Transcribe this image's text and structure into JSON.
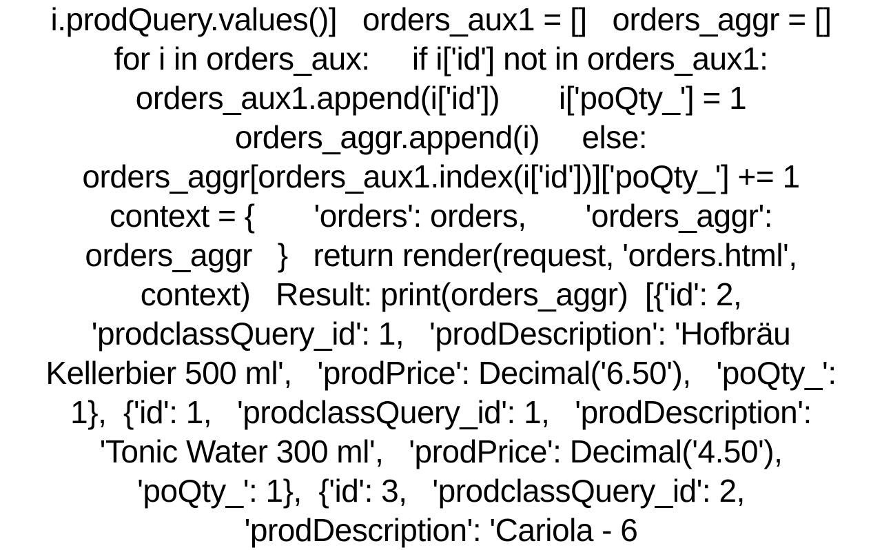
{
  "text_block": "i.prodQuery.values()]   orders_aux1 = []   orders_aggr = []   for i in orders_aux:     if i['id'] not in orders_aux1:       orders_aux1.append(i['id'])       i['poQty_'] = 1       orders_aggr.append(i)     else:       orders_aggr[orders_aux1.index(i['id'])]['poQty_'] += 1   context = {       'orders': orders,       'orders_aggr': orders_aggr   }   return render(request, 'orders.html', context)   Result: print(orders_aggr)  [{'id': 2,   'prodclassQuery_id': 1,   'prodDescription': 'Hofbräu Kellerbier 500 ml',   'prodPrice': Decimal('6.50'),   'poQty_': 1},  {'id': 1,   'prodclassQuery_id': 1,   'prodDescription': 'Tonic Water 300 ml',   'prodPrice': Decimal('4.50'),   'poQty_': 1},  {'id': 3,   'prodclassQuery_id': 2,   'prodDescription': 'Cariola - 6"
}
